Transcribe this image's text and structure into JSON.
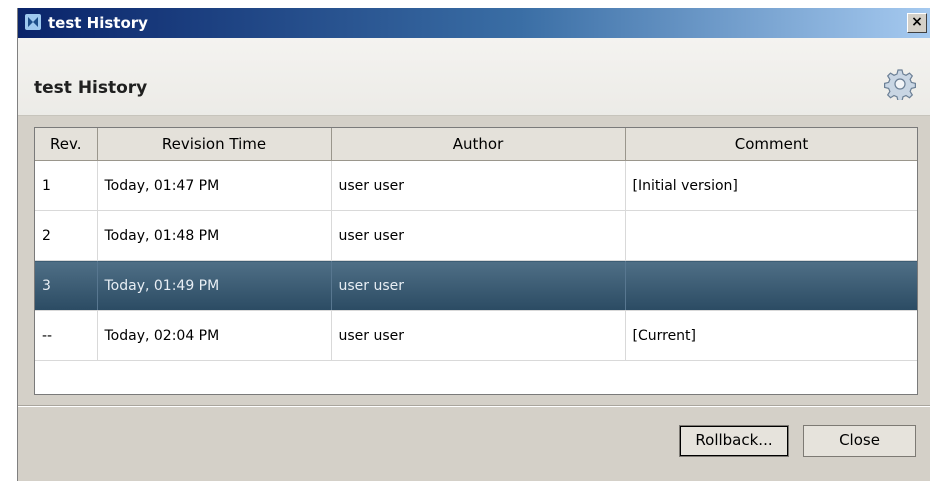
{
  "window": {
    "title": "test History",
    "close_label": "×"
  },
  "header": {
    "title": "test History",
    "settings_icon": "gear-icon"
  },
  "table": {
    "columns": [
      "Rev.",
      "Revision Time",
      "Author",
      "Comment"
    ],
    "rows": [
      {
        "rev": "1",
        "time": "Today, 01:47 PM",
        "author": "user user",
        "comment": "[Initial version]"
      },
      {
        "rev": "2",
        "time": "Today, 01:48 PM",
        "author": "user user",
        "comment": ""
      },
      {
        "rev": "3",
        "time": "Today, 01:49 PM",
        "author": "user user",
        "comment": ""
      },
      {
        "rev": "--",
        "time": "Today, 02:04 PM",
        "author": "user user",
        "comment": "[Current]"
      }
    ],
    "selected_row": "3"
  },
  "footer": {
    "rollback_label": "Rollback...",
    "close_label": "Close"
  },
  "colors": {
    "selection": "#3b5a72",
    "titlebar": "#0a246a"
  }
}
